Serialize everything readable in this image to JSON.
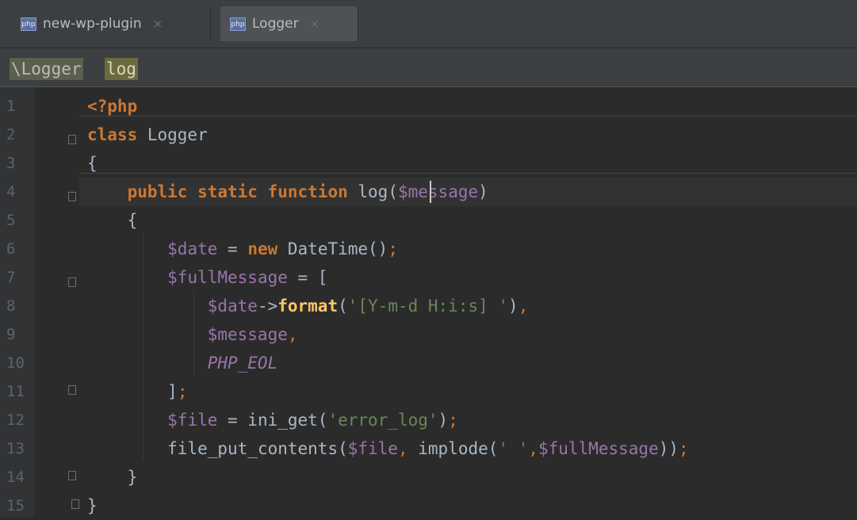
{
  "tabs": [
    {
      "label": "new-wp-plugin",
      "icon": "php-file-icon",
      "close": "×"
    },
    {
      "label": "Logger",
      "icon": "php-file-icon",
      "close": "×",
      "active": true
    }
  ],
  "breadcrumb": {
    "class": "\\Logger",
    "method": "log"
  },
  "php_badge": "php",
  "line_numbers": [
    "1",
    "2",
    "3",
    "4",
    "5",
    "6",
    "7",
    "8",
    "9",
    "10",
    "11",
    "12",
    "13",
    "14",
    "15"
  ],
  "code": {
    "l1": {
      "open": "<?php"
    },
    "l2": {
      "kw": "class",
      "name": " Logger"
    },
    "l3": {
      "brace": "{"
    },
    "l4": {
      "indent": "    ",
      "kw": "public static function",
      "sp": " ",
      "fn": "log",
      "p1": "(",
      "var": "$message",
      "p2": ")"
    },
    "l5": {
      "text": "    {"
    },
    "l6": {
      "indent": "        ",
      "var": "$date",
      "eq": " = ",
      "kw": "new",
      "rest": " DateTime()",
      "semi": ";"
    },
    "l7": {
      "indent": "        ",
      "var": "$fullMessage",
      "rest": " = ["
    },
    "l8": {
      "indent": "            ",
      "var": "$date",
      "arrow": "->",
      "fn": "format",
      "p1": "(",
      "str": "'[Y-m-d H:i:s] '",
      "p2": ")",
      "comma": ","
    },
    "l9": {
      "indent": "            ",
      "var": "$message",
      "comma": ","
    },
    "l10": {
      "indent": "            ",
      "const": "PHP_EOL"
    },
    "l11": {
      "indent": "        ",
      "text": "]",
      "semi": ";"
    },
    "l12": {
      "indent": "        ",
      "var": "$file",
      "eq": " = ini_get(",
      "str": "'error_log'",
      "p2": ")",
      "semi": ";"
    },
    "l13": {
      "indent": "        ",
      "fn": "file_put_contents(",
      "var1": "$file",
      "comma": ",",
      "mid": " implode(",
      "str": "' '",
      "comma2": ",",
      "var2": "$fullMessage",
      "end": "))",
      "semi": ";"
    },
    "l14": {
      "text": "    }"
    },
    "l15": {
      "text": "}"
    }
  }
}
